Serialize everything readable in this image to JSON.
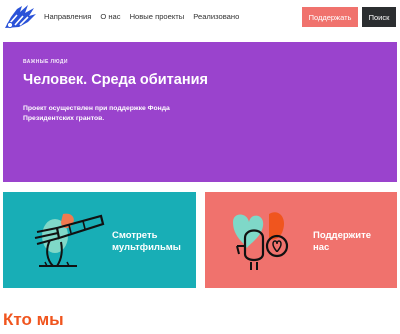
{
  "header": {
    "logo_icon": "hand-logo-icon",
    "nav": [
      "Направления",
      "О нас",
      "Новые проекты",
      "Реализовано"
    ],
    "support_label": "Поддержать",
    "search_label": "Поиск"
  },
  "hero": {
    "tag": "ВАЖНЫЕ ЛЮДИ",
    "title": "Человек. Среда обитания",
    "description": "Проект осуществлен при поддержке Фонда Президентских грантов."
  },
  "cards": [
    {
      "label": "Смотреть мультфильмы",
      "icon": "telescope-illustration-icon"
    },
    {
      "label": "Поддержите нас",
      "icon": "heart-lantern-illustration-icon"
    }
  ],
  "about": {
    "title": "Кто мы"
  },
  "colors": {
    "purple": "#9a43cd",
    "teal": "#18aeb6",
    "coral": "#f0726d",
    "orange": "#f0551e",
    "dark": "#2b2e30",
    "logo_blue": "#2a52d8"
  }
}
